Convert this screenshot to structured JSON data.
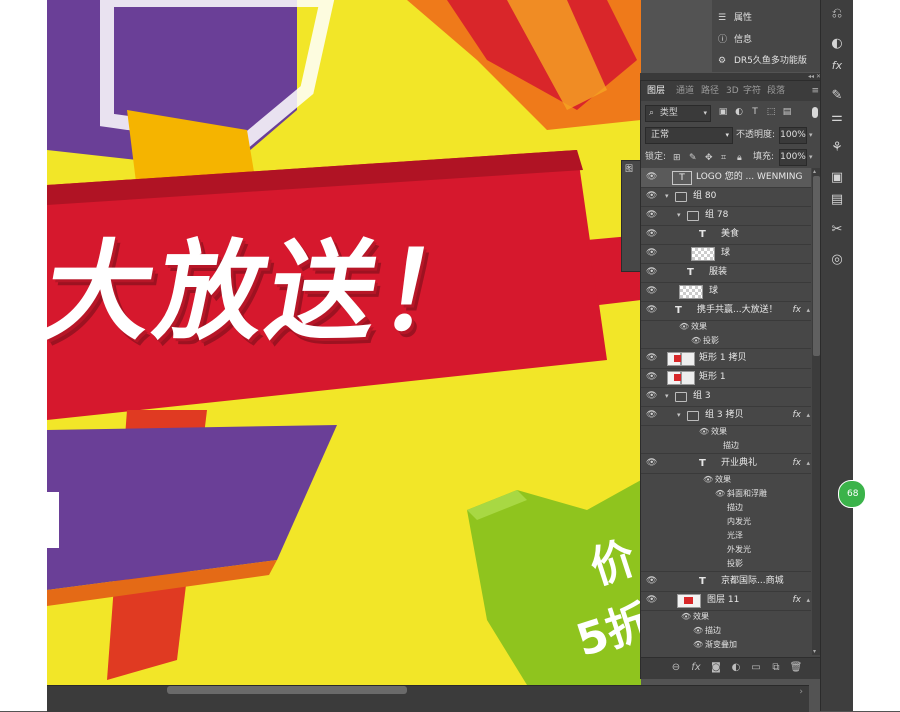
{
  "canvas": {
    "banner_text": "大放送！",
    "promo_line1": "价",
    "promo_line2": "5折",
    "colors": {
      "background": "#f2e628",
      "red_band": "#d6182d",
      "purple": "#6a3f97",
      "green": "#8fc41e"
    }
  },
  "top_panel": {
    "items": [
      {
        "label": "属性",
        "icon": "sliders-icon"
      },
      {
        "label": "信息",
        "icon": "info-icon"
      },
      {
        "label": "DR5久鱼多功能版",
        "icon": "plugin-icon"
      }
    ]
  },
  "layers_panel": {
    "tabs": [
      "图层",
      "通道",
      "路径",
      "3D",
      "字符",
      "段落"
    ],
    "active_tab": "图层",
    "filter_label": "类型",
    "blend_mode": "正常",
    "opacity_label": "不透明度:",
    "opacity_value": "100%",
    "lock_label": "锁定:",
    "fill_label": "填充:",
    "fill_value": "100%",
    "layers": [
      {
        "kind": "text-box",
        "name": "LOGO 您的 ... WENMING",
        "selected": true
      },
      {
        "kind": "group",
        "name": "组 80"
      },
      {
        "kind": "group",
        "name": "组 78"
      },
      {
        "kind": "text",
        "name": "美食"
      },
      {
        "kind": "image",
        "name": "球"
      },
      {
        "kind": "text",
        "name": "服装"
      },
      {
        "kind": "image",
        "name": "球"
      },
      {
        "kind": "text",
        "name": "携手共赢...大放送！",
        "fx": true
      },
      {
        "kind": "effect-header",
        "name": "效果"
      },
      {
        "kind": "effect",
        "name": "投影"
      },
      {
        "kind": "shape",
        "name": "矩形 1 拷贝"
      },
      {
        "kind": "shape",
        "name": "矩形 1"
      },
      {
        "kind": "group",
        "name": "组 3"
      },
      {
        "kind": "group",
        "name": "组 3 拷贝",
        "fx": true
      },
      {
        "kind": "effect-header",
        "name": "效果"
      },
      {
        "kind": "effect",
        "name": "描边"
      },
      {
        "kind": "text",
        "name": "开业典礼",
        "fx": true
      },
      {
        "kind": "effect-header",
        "name": "效果"
      },
      {
        "kind": "effect",
        "name": "斜面和浮雕"
      },
      {
        "kind": "effect-noeye",
        "name": "描边"
      },
      {
        "kind": "effect-noeye",
        "name": "内发光"
      },
      {
        "kind": "effect-noeye",
        "name": "光泽"
      },
      {
        "kind": "effect-noeye",
        "name": "外发光"
      },
      {
        "kind": "effect-noeye",
        "name": "投影"
      },
      {
        "kind": "text",
        "name": "京都国际...商城"
      },
      {
        "kind": "image-red",
        "name": "图层 11",
        "fx": true
      },
      {
        "kind": "effect-header",
        "name": "效果"
      },
      {
        "kind": "effect",
        "name": "描边"
      },
      {
        "kind": "effect",
        "name": "渐变叠加"
      }
    ]
  },
  "float_panel": {
    "label": "图"
  },
  "badge": {
    "value": "68"
  },
  "sidebar_tools": [
    "history-icon",
    "adjust-icon",
    "fx-icon",
    "brush-icon",
    "sliders-icon",
    "clone-icon",
    "navigator-icon",
    "document-icon",
    "tools-icon",
    "3d-icon"
  ]
}
